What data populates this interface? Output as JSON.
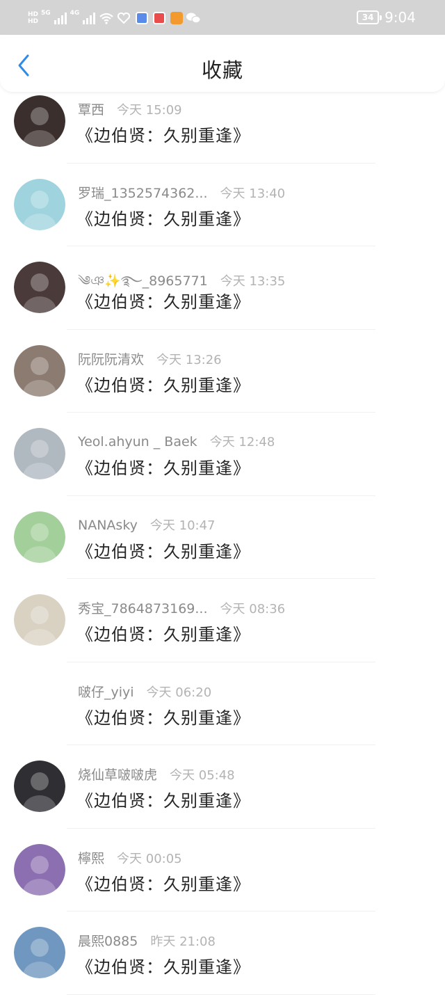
{
  "status_bar": {
    "sim1_label": "HD",
    "network1": "5G",
    "sim2_label": "HD",
    "network2": "4G",
    "battery": "34",
    "time": "9:04",
    "app_icon_colors": [
      "#5a8be8",
      "#e84c4c",
      "#f39a2e"
    ]
  },
  "header": {
    "title": "收藏",
    "back_icon": "chevron-left-icon",
    "accent_color": "#2f8be6"
  },
  "items": [
    {
      "name": "覃西",
      "time": "今天 15:09",
      "title": "《边伯贤：久别重逢》",
      "avatar_color": "#3a2f2c"
    },
    {
      "name": "罗瑞_1352574362...",
      "time": "今天 13:40",
      "title": "《边伯贤：久别重逢》",
      "avatar_color": "#9fd4de"
    },
    {
      "name": "༄ঞ✨࿐_8965771",
      "time": "今天 13:35",
      "title": "《边伯贤：久别重逢》",
      "avatar_color": "#4a3a3a"
    },
    {
      "name": "阮阮阮清欢",
      "time": "今天 13:26",
      "title": "《边伯贤：久别重逢》",
      "avatar_color": "#8c7b70"
    },
    {
      "name": "Yeol.ahyun _ Baek",
      "time": "今天 12:48",
      "title": "《边伯贤：久别重逢》",
      "avatar_color": "#b0b8c0"
    },
    {
      "name": "NANAsky",
      "time": "今天 10:47",
      "title": "《边伯贤：久别重逢》",
      "avatar_color": "#a3cf9a"
    },
    {
      "name": "秀宝_7864873169...",
      "time": "今天 08:36",
      "title": "《边伯贤：久别重逢》",
      "avatar_color": "#d9d2c2"
    },
    {
      "name": "啵仔_yiyi",
      "time": "今天 06:20",
      "title": "《边伯贤：久别重逢》",
      "avatar_color": "#ffffff"
    },
    {
      "name": "烧仙草啵啵虎",
      "time": "今天 05:48",
      "title": "《边伯贤：久别重逢》",
      "avatar_color": "#2e2e33"
    },
    {
      "name": "檸熙",
      "time": "今天 00:05",
      "title": "《边伯贤：久别重逢》",
      "avatar_color": "#8c6fb0"
    },
    {
      "name": "晨熙0885",
      "time": "昨天 21:08",
      "title": "《边伯贤：久别重逢》",
      "avatar_color": "#6f97bf"
    }
  ]
}
